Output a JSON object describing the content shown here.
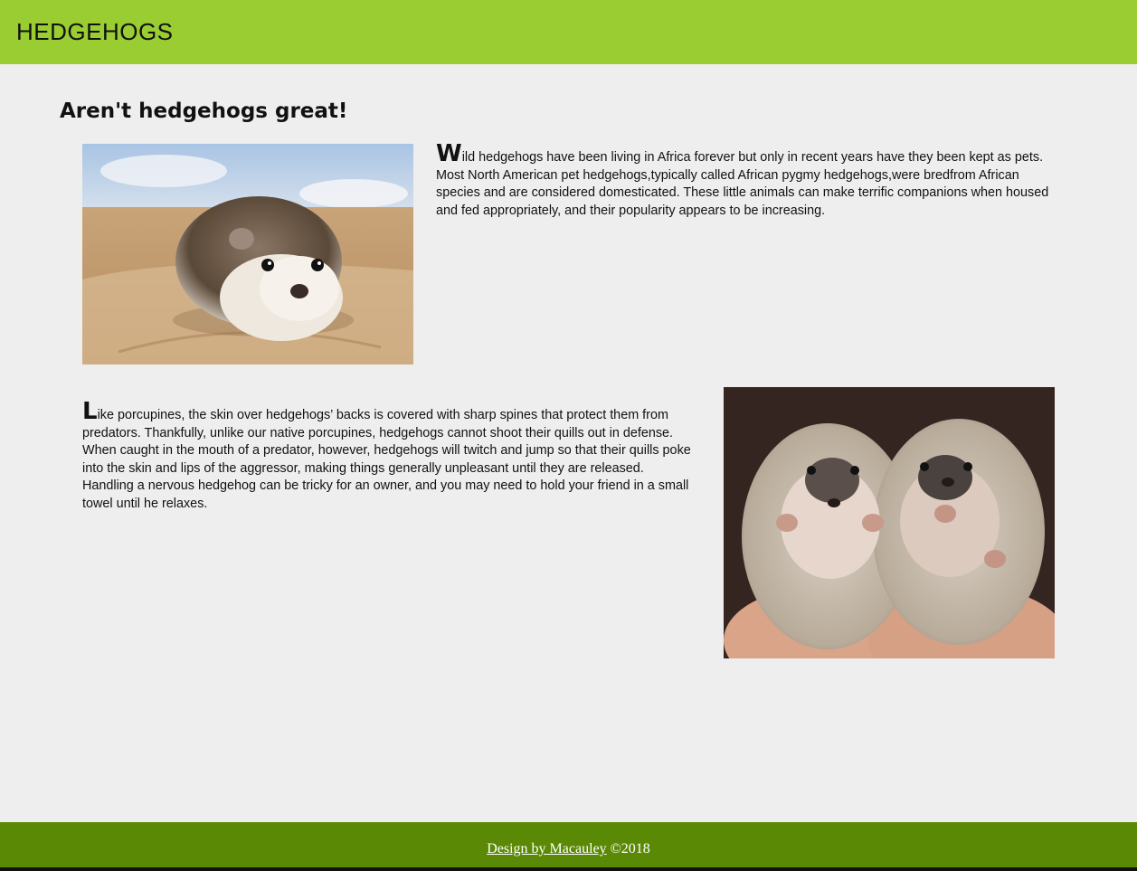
{
  "header": {
    "title": "HEDGEHOGS",
    "background_color": "#9acd32"
  },
  "main": {
    "heading": "Aren't hedgehogs great!",
    "section_1": {
      "image_subject": "hedgehog-on-sandy-rock",
      "dropcap": "W",
      "text": "ild hedgehogs have been living in Africa forever but only in recent years have they been kept as pets. Most North American pet hedgehogs,typically called African pygmy hedgehogs,were bredfrom African species and are considered domesticated. These little animals can make terrific companions when housed and fed appropriately, and their popularity appears to be increasing."
    },
    "section_2": {
      "image_subject": "two-hedgehogs-held-in-hands",
      "dropcap": "L",
      "text": "ike porcupines, the skin over hedgehogs’ backs is covered with sharp spines that protect them from predators. Thankfully, unlike our native porcupines, hedgehogs cannot shoot their quills out in defense. When caught in the mouth of a predator, however, hedgehogs will twitch and jump so that their quills poke into the skin and lips of the aggressor, making things generally unpleasant until they are released. Handling a nervous hedgehog can be tricky for an owner, and you may need to hold your friend in a small towel until he relaxes."
    }
  },
  "footer": {
    "link_text": "Design by Macauley",
    "suffix": " ©2018",
    "background_color": "#5a8a05"
  },
  "colors": {
    "page_background": "#eeeeee",
    "text": "#111111"
  }
}
